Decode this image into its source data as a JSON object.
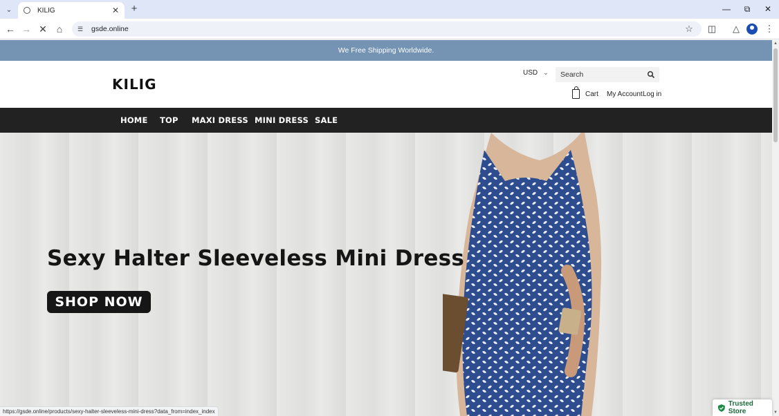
{
  "browser": {
    "tab_title": "KILIG",
    "url": "gsde.online",
    "status_url": "https://gsde.online/products/sexy-halter-sleeveless-mini-dress?data_from=index_index"
  },
  "site": {
    "announcement": "We Free Shipping Worldwide.",
    "logo": "KILIG",
    "currency": "USD",
    "search_placeholder": "Search",
    "cart_label": "Cart",
    "account_label": "My Account",
    "login_label": "Log in",
    "nav": [
      "HOME",
      "TOP",
      "MAXI DRESS",
      "MINI DRESS",
      "SALE"
    ]
  },
  "hero": {
    "title": "Sexy Halter Sleeveless Mini Dress",
    "button": "SHOP NOW"
  },
  "badge": {
    "trusted": "Trusted Store",
    "color": "#1b6c3a"
  },
  "colors": {
    "announcement_bg": "#7594b4",
    "nav_bg": "#222222",
    "dress_blue": "#2e4d8f"
  }
}
